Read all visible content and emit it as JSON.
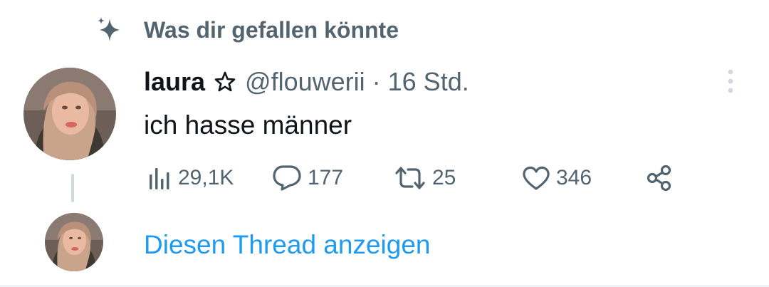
{
  "context": {
    "label": "Was dir gefallen könnte",
    "icon": "sparkle-icon"
  },
  "tweet": {
    "display_name": "laura",
    "name_badge_icon": "star-outline-icon",
    "handle": "@flouwerii",
    "separator": "·",
    "time": "16 Std.",
    "text": "ich hasse männer",
    "more_icon": "more-vertical-icon"
  },
  "actions": {
    "views": {
      "icon": "analytics-icon",
      "count": "29,1K"
    },
    "replies": {
      "icon": "reply-icon",
      "count": "177"
    },
    "retweets": {
      "icon": "retweet-icon",
      "count": "25"
    },
    "likes": {
      "icon": "heart-icon",
      "count": "346"
    },
    "share": {
      "icon": "share-icon"
    }
  },
  "thread": {
    "show_label": "Diesen Thread anzeigen"
  },
  "colors": {
    "text_primary": "#0f1419",
    "text_secondary": "#536471",
    "link": "#1d9bf0",
    "divider": "#cfd9de"
  }
}
